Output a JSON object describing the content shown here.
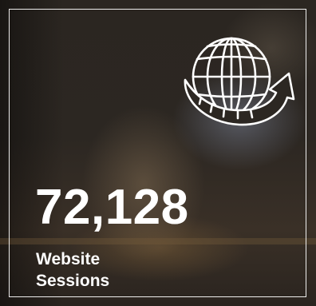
{
  "stat": {
    "value": "72,128",
    "label_line1": "Website",
    "label_line2": "Sessions",
    "icon": "globe-with-arrow-icon"
  },
  "colors": {
    "text": "#ffffff",
    "border": "#ffffff",
    "background": "#2b2621"
  }
}
